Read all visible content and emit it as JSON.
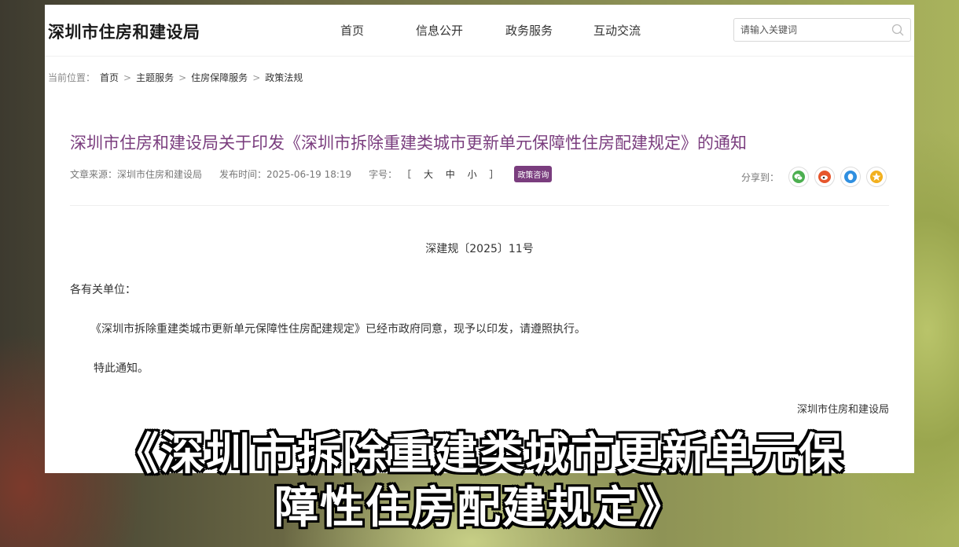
{
  "site": {
    "title": "深圳市住房和建设局"
  },
  "nav": {
    "items": [
      "首页",
      "信息公开",
      "政务服务",
      "互动交流"
    ]
  },
  "search": {
    "placeholder": "请输入关键词"
  },
  "breadcrumb": {
    "label": "当前位置：",
    "items": [
      "首页",
      "主题服务",
      "住房保障服务",
      "政策法规"
    ],
    "separator": ">"
  },
  "article": {
    "title": "深圳市住房和建设局关于印发《深圳市拆除重建类城市更新单元保障性住房配建规定》的通知",
    "source": "文章来源：深圳市住房和建设局",
    "date": "发布时间：2025-06-19 18:19",
    "fontsize_label": "字号：",
    "fontsize_options": "［ 大  中  小 ］",
    "tag": "政策咨询",
    "share_label": "分享到：",
    "doc_number": "深建规〔2025〕11号",
    "salutation": "各有关单位：",
    "body": "《深圳市拆除重建类城市更新单元保障性住房配建规定》已经市政府同意，现予以印发，请遵照执行。",
    "closing": "特此通知。",
    "signature": "深圳市住房和建设局"
  },
  "share_icons": [
    "wechat-icon",
    "weibo-icon",
    "qq-icon",
    "qzone-icon"
  ],
  "colors": {
    "title": "#7a3d7e",
    "tag": "#7a3d7e",
    "wechat": "#4caf50",
    "weibo": "#e6562d",
    "qq": "#2f8fe0",
    "qzone": "#f2b01e"
  },
  "subtitle": {
    "line1": "《深圳市拆除重建类城市更新单元保",
    "line2": "障性住房配建规定》"
  }
}
